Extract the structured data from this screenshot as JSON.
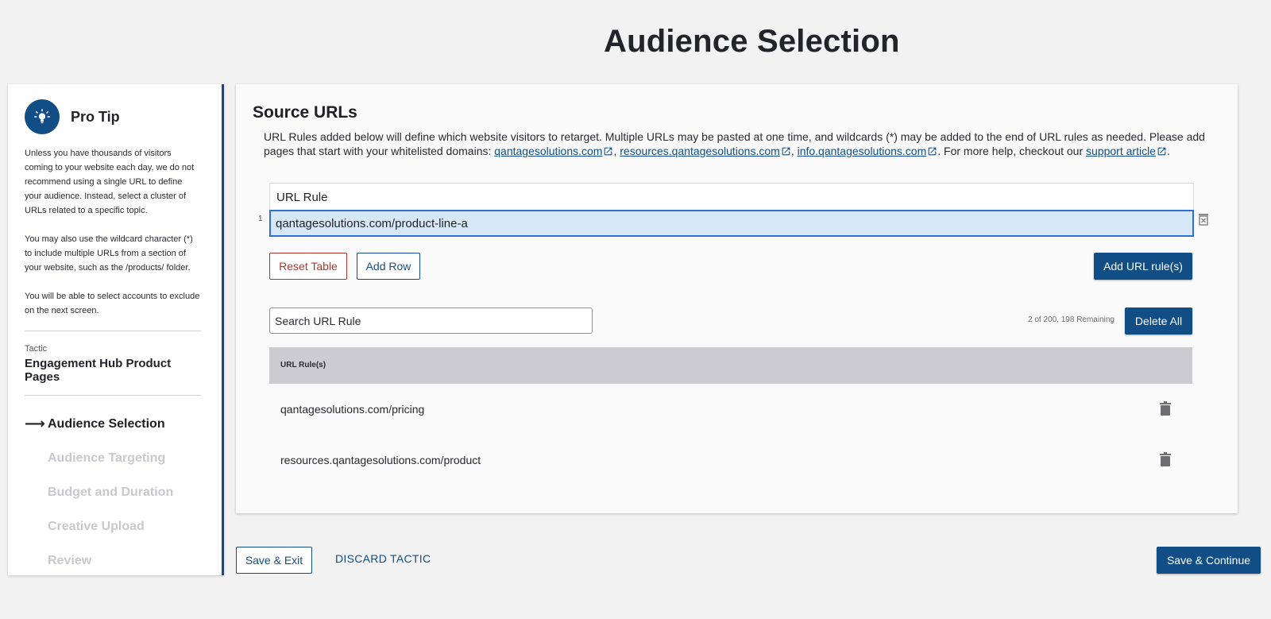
{
  "page": {
    "title": "Audience Selection"
  },
  "sidebar": {
    "tip_title": "Pro Tip",
    "tip_paragraphs": [
      "Unless you have thousands of visitors coming to your website each day, we do not recommend using a single URL to define your audience. Instead, select a cluster of URLs related to a specific topic.",
      "You may also use the wildcard character (*) to include multiple URLs from a section of your website, such as the /products/ folder.",
      "You will be able to select accounts to exclude on the next screen."
    ],
    "tactic_label": "Tactic",
    "tactic_name": "Engagement Hub Product Pages",
    "steps": [
      {
        "label": "Audience Selection",
        "active": true
      },
      {
        "label": "Audience Targeting"
      },
      {
        "label": "Budget and Duration"
      },
      {
        "label": "Creative Upload"
      },
      {
        "label": "Review"
      }
    ],
    "arrow": "⟶"
  },
  "main": {
    "title": "Source URLs",
    "desc_part1": "URL Rules added below will define which website visitors to retarget. Multiple URLs may be pasted at one time, and wildcards (*) may be added to the end of URL rules as needed. Please add pages that start with your whitelisted domains: ",
    "domains": [
      "qantagesolutions.com",
      "resources.qantagesolutions.com",
      "info.qantagesolutions.com"
    ],
    "sep": ", ",
    "desc_part2": ". For more help, checkout our ",
    "support_link": "support article",
    "desc_end": ".",
    "rule_header": "URL Rule",
    "rule_row_number": "1",
    "rule_row_value": "qantagesolutions.com/product-line-a",
    "reset_label": "Reset Table",
    "add_row_label": "Add Row",
    "add_url_label": "Add URL rule(s)",
    "search_placeholder": "Search URL Rule",
    "count_text": "2 of 200, 198 Remaining",
    "delete_all_label": "Delete All",
    "list_header": "URL Rule(s)",
    "list_rows": [
      "qantagesolutions.com/pricing",
      "resources.qantagesolutions.com/product"
    ]
  },
  "footer": {
    "save_exit_label": "Save & Exit",
    "discard_label": "DISCARD TACTIC",
    "save_continue_label": "Save & Continue"
  },
  "colors": {
    "primary": "#114e85",
    "danger": "#b2362c",
    "selected_row": "#d6e8f7"
  }
}
